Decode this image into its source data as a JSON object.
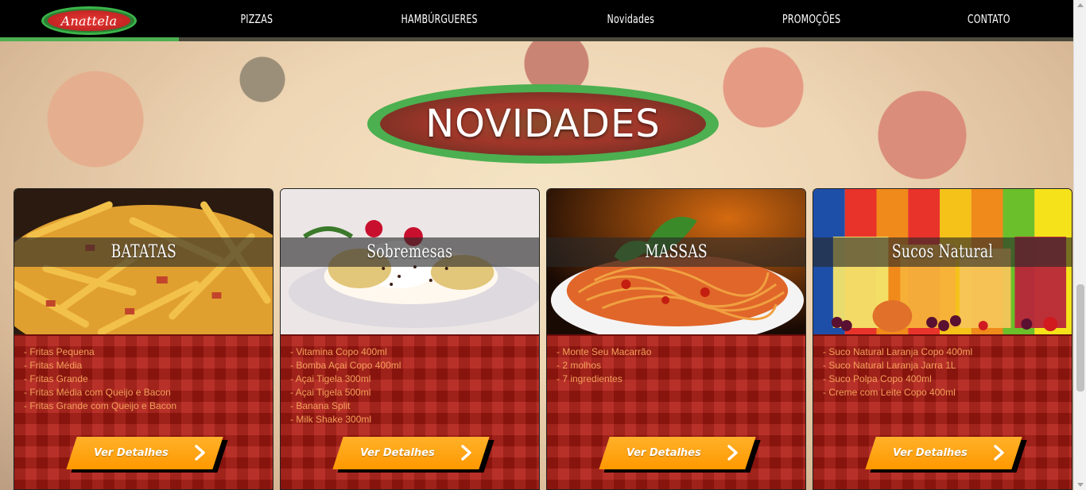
{
  "nav": {
    "logo_text": "Anattela",
    "items": [
      "PIZZAS",
      "HAMBÚRGUERES",
      "Novidades",
      "PROMOÇÕES",
      "CONTATO"
    ]
  },
  "section": {
    "title": "NOVIDADES"
  },
  "cards": [
    {
      "title": "BATATAS",
      "items": [
        "- Fritas Pequena",
        "- Fritas Média",
        "- Fritas Grande",
        "- Fritas Média com Queijo e Bacon",
        "- Fritas Grande com Queijo e Bacon"
      ],
      "button": "Ver Detalhes"
    },
    {
      "title": "Sobremesas",
      "items": [
        "- Vitamina Copo 400ml",
        "- Bomba Açai Copo 400ml",
        "- Açai Tigela 300ml",
        "- Açai Tigela 500ml",
        "- Banana Split",
        "- Milk Shake 300ml"
      ],
      "button": "Ver Detalhes"
    },
    {
      "title": "MASSAS",
      "items": [
        "- Monte Seu Macarrão",
        "- 2 molhos",
        "- 7 ingredientes"
      ],
      "button": "Ver Detalhes"
    },
    {
      "title": "Sucos Natural",
      "items": [
        "- Suco Natural Laranja Copo 400ml",
        "- Suco Natural Laranja Jarra 1L",
        "- Suco Polpa Copo 400ml",
        "- Creme com Leite Copo 400ml"
      ],
      "button": "Ver Detalhes"
    }
  ],
  "colors": {
    "nav_bg": "#000000",
    "accent_green": "#4caf50",
    "card_red": "#b01a12",
    "button_orange": "#ff9800",
    "list_text": "#f4a05a"
  }
}
